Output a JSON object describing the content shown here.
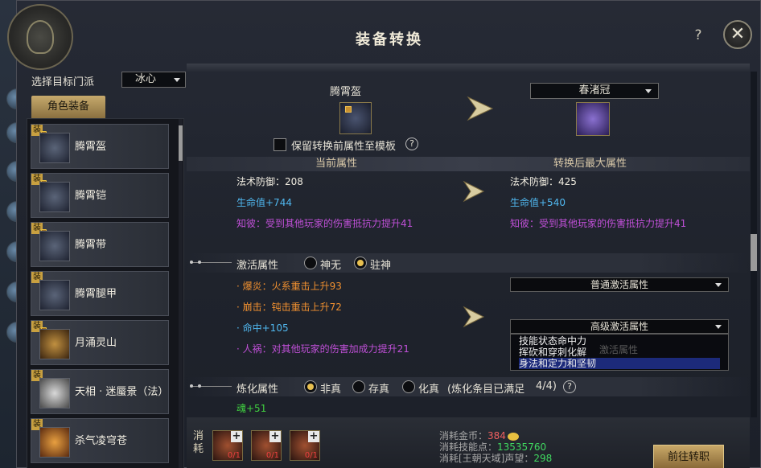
{
  "window": {
    "title": "装备转换",
    "help_label": "?",
    "close_label": "✕"
  },
  "target": {
    "label": "选择目标门派",
    "value": "冰心"
  },
  "side": {
    "tab_label": "角色装备",
    "badge": "装",
    "items": [
      {
        "name": "腾霄盔"
      },
      {
        "name": "腾霄铠"
      },
      {
        "name": "腾霄带"
      },
      {
        "name": "腾霄腿甲"
      },
      {
        "name": "月涌灵山"
      },
      {
        "name": "天相 · 迷蜃景（法）"
      },
      {
        "name": "杀气凌穹苍"
      }
    ]
  },
  "preview": {
    "current_name": "腾霄盔",
    "keep_label": "保留转换前属性至模板",
    "keep_help": "?",
    "target_select": "春渚冠"
  },
  "headers": {
    "current": "当前属性",
    "after": "转换后最大属性"
  },
  "attributes": {
    "current": [
      "法术防御：208",
      "生命值+744",
      "知彼：受到其他玩家的伤害抵抗力提升41"
    ],
    "after": [
      "法术防御：425",
      "生命值+540",
      "知彼：受到其他玩家的伤害抵抗力提升41"
    ]
  },
  "activate": {
    "label": "激活属性",
    "options": [
      "神无",
      "驻神"
    ],
    "selected": "驻神",
    "lines": [
      "· 爆炎：火系重击上升93",
      "· 崩击：钝击重击上升72",
      "· 命中+105",
      "· 人祸：对其他玩家的伤害加成力提升21"
    ],
    "dropdown_normal": "普通激活属性",
    "dropdown_advanced": "高级激活属性",
    "dropdown_hidden": "激活属性",
    "list_options": [
      "技能状态命中力",
      "挥砍和穿刺化解",
      "身法和定力和坚韧"
    ],
    "list_selected": "身法和定力和坚韧"
  },
  "refine": {
    "label": "炼化属性",
    "options": [
      "非真",
      "存真",
      "化真"
    ],
    "selected": "非真",
    "note": "(炼化条目已满足",
    "count": "4/4)",
    "help": "?",
    "soul": "魂+51"
  },
  "cost": {
    "label": "消耗",
    "materials": [
      {
        "count": "0/1"
      },
      {
        "count": "0/1"
      },
      {
        "count": "0/1"
      }
    ],
    "plus": "+",
    "gold_label": "消耗金币：",
    "gold_value": "384",
    "skill_label": "消耗技能点：",
    "skill_value": "13535760",
    "rep_label": "消耗[王朝天域]声望：",
    "rep_value": "298",
    "go_label": "前往转职"
  }
}
